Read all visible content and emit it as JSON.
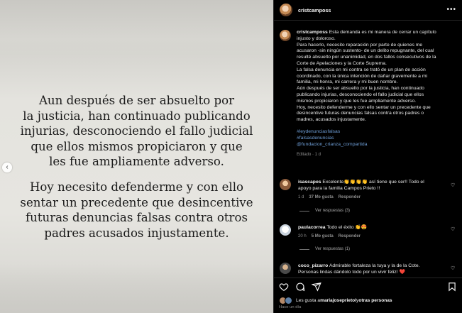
{
  "image": {
    "paragraph1": [
      "Aun  después de ser absuelto por",
      "la justicia, han continuado publicando",
      "injurias, desconociendo el fallo judicial",
      "que ellos mismos propiciaron y que",
      "les fue ampliamente adverso."
    ],
    "paragraph2": [
      "Hoy necesito defenderme y con ello",
      "sentar un precedente que desincentive",
      "futuras denuncias falsas contra otros",
      "padres acusados injustamente."
    ],
    "prev_arrow": "‹"
  },
  "post": {
    "header": {
      "username": "cristcamposs",
      "more": "•••"
    },
    "caption": {
      "username": "cristcamposs",
      "lines": [
        "Esta demanda es mi manera de cerrar un capítulo",
        "injusto y doloroso.",
        "Para hacerlo, necesito reparación por parte de quienes me",
        "acusaron -sin ningún sustento- de un delito repugnante, del cual",
        "resulté absuelto por unanimidad, en dos fallos consecutivos de la",
        "Corte de Apelaciones y la Corte Suprema.",
        "La falsa denuncia en mi contra se trató de un plan de acción",
        "coordinado, con la única intención de dañar gravemente a mi",
        "familia, mi honra, mi carrera y mi buen nombre.",
        "Aún después de ser absuelto por la justicia, han continuado",
        "publicando injurias, desconociendo el fallo judicial que ellos",
        "mismos propiciaron y que les fue ampliamente adverso.",
        "Hoy, necesito defenderme y con ello sentar un precedente que",
        "desincentive futuras denuncias falsas contra otros padres o",
        "madres, acusados injustamente."
      ],
      "hashtags": [
        "#leydenunciasfalsas",
        "#falsasdenuncias",
        "@fundacion_crianza_compartida"
      ],
      "edited": "Editado · 1 d"
    },
    "comments": [
      {
        "username": "isascapes",
        "lines": [
          "Excelente👏👏👏👏 así tiene que ser!! Todo el",
          "apoyo para la familia Campos Prieto !!"
        ],
        "time": "1 d",
        "likes": "37 Me gusta",
        "reply": "Responder",
        "replies": "Ver respuestas (3)"
      },
      {
        "username": "paulacorrea",
        "lines": [
          "Todo el éxito 👏😍"
        ],
        "time": "20 h",
        "likes": "5 Me gusta",
        "reply": "Responder",
        "replies": "Ver respuestas (1)"
      },
      {
        "username": "coco_pizarro",
        "lines": [
          "Admirable fortaleza la tuya y la de la Cote.",
          "Personas lindas dándolo todo por un vivir feliz! ❤️"
        ],
        "time": "",
        "likes": "",
        "reply": "",
        "replies": ""
      }
    ],
    "likes": {
      "prefix": "Les gusta a ",
      "user": "mariajoseprietol",
      "middle": " y ",
      "others": "otras personas"
    },
    "time_ago": "Hace un día"
  },
  "colors": {
    "background": "#000000",
    "hashtag": "#6f9fd8",
    "muted": "#8e8e8e",
    "image_bg": "#e4e3de"
  }
}
